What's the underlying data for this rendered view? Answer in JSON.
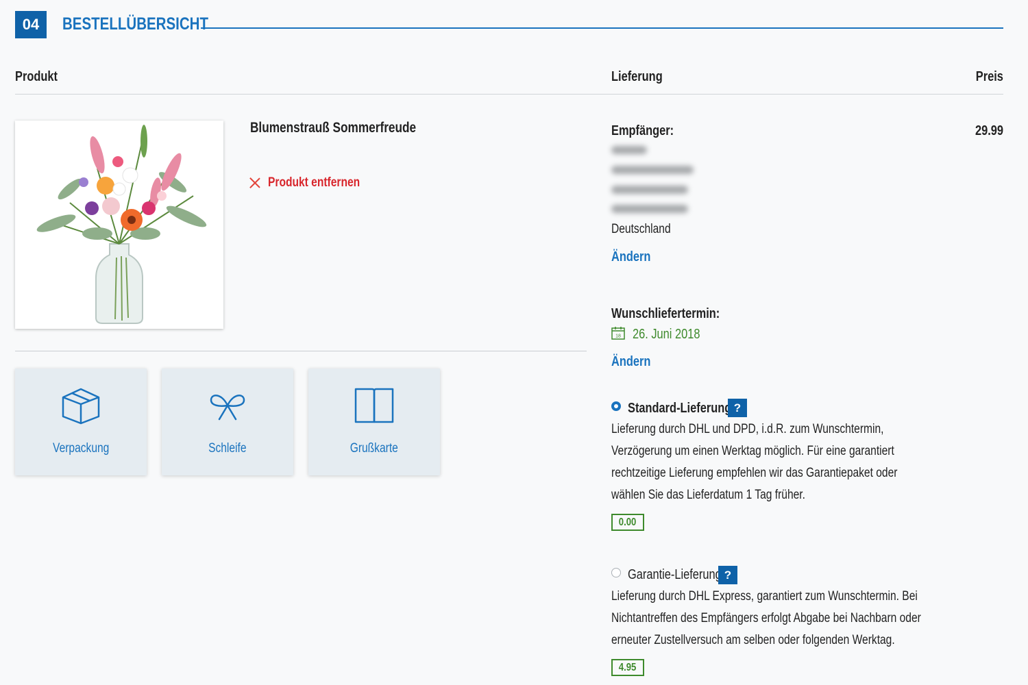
{
  "header": {
    "step": "04",
    "title": "BESTELLÜBERSICHT"
  },
  "columns": {
    "product": "Produkt",
    "delivery": "Lieferung",
    "price": "Preis"
  },
  "product": {
    "name": "Blumenstrauß Sommerfreude",
    "remove_label": "Produkt entfernen",
    "price": "29.99"
  },
  "extras": [
    {
      "label": "Verpackung",
      "icon": "box-icon"
    },
    {
      "label": "Schleife",
      "icon": "ribbon-icon"
    },
    {
      "label": "Grußkarte",
      "icon": "card-icon"
    }
  ],
  "recipient": {
    "label": "Empfänger:",
    "country": "Deutschland",
    "change_label": "Ändern"
  },
  "delivery_date": {
    "label": "Wunschliefertermin:",
    "value": "26. Juni 2018",
    "calendar_day": "18",
    "change_label": "Ändern"
  },
  "shipping_options": [
    {
      "name": "Standard-Lieferung",
      "selected": true,
      "help": "?",
      "lines": [
        "Lieferung durch DHL und DPD, i.d.R. zum Wunschtermin,",
        "Verzögerung um einen Werktag möglich. Für eine garantiert",
        "rechtzeitige Lieferung empfehlen wir das Garantiepaket oder",
        "wählen Sie das Lieferdatum 1 Tag früher."
      ],
      "price": "0.00"
    },
    {
      "name": "Garantie-Lieferung",
      "selected": false,
      "help": "?",
      "lines": [
        "Lieferung durch DHL Express, garantiert zum Wunschtermin. Bei",
        "Nichtantreffen des Empfängers erfolgt Abgabe bei Nachbarn oder",
        "erneuter Zustellversuch am selben oder folgenden Werktag."
      ],
      "price": "4.95"
    }
  ],
  "colors": {
    "accent": "#1a73be",
    "badge": "#0f62a8",
    "remove": "#d8262c",
    "price_green": "#3e8a2c"
  }
}
